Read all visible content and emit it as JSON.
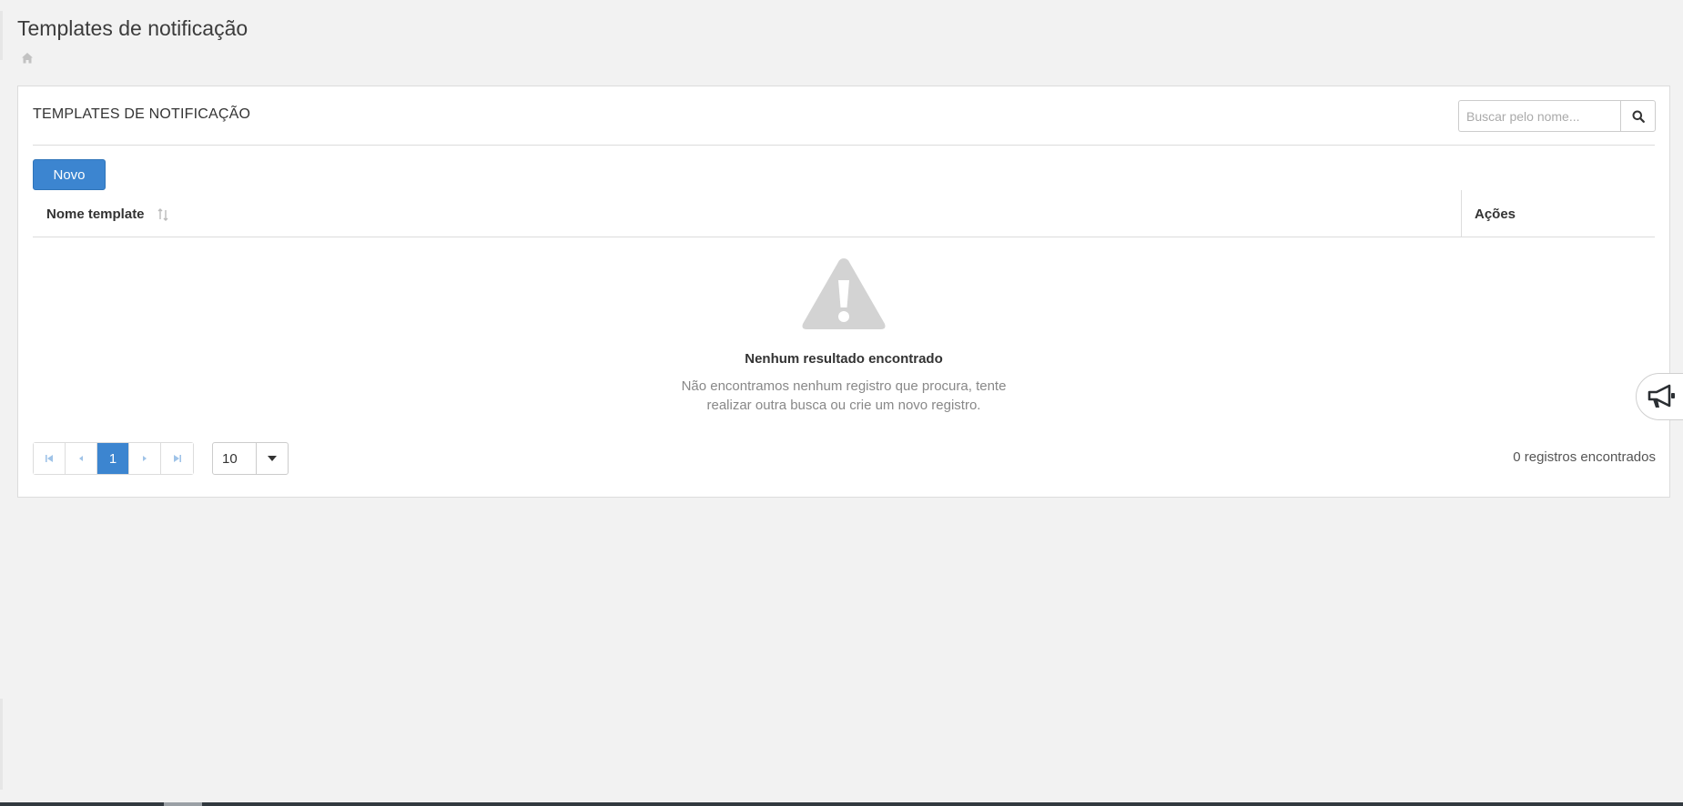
{
  "page": {
    "title": "Templates de notificação"
  },
  "breadcrumb": {
    "icon": "home-icon"
  },
  "panel": {
    "title": "TEMPLATES DE NOTIFICAÇÃO",
    "search": {
      "placeholder": "Buscar pelo nome...",
      "value": "",
      "icon": "search-icon"
    },
    "new_button": "Novo"
  },
  "table": {
    "columns": [
      {
        "label": "Nome template",
        "sort_icon": "sort-icon"
      },
      {
        "label": "Ações"
      }
    ],
    "rows": []
  },
  "empty_state": {
    "icon": "warning-icon",
    "title": "Nenhum resultado encontrado",
    "description": "Não encontramos nenhum registro que procura, tente realizar outra busca ou crie um novo registro."
  },
  "pagination": {
    "current_page": "1",
    "page_size": "10",
    "records_label": "0 registros encontrados"
  },
  "floating": {
    "icon": "megaphone-icon"
  },
  "colors": {
    "primary": "#3c85d0",
    "background": "#f2f2f2",
    "border": "#dcdcdc"
  }
}
